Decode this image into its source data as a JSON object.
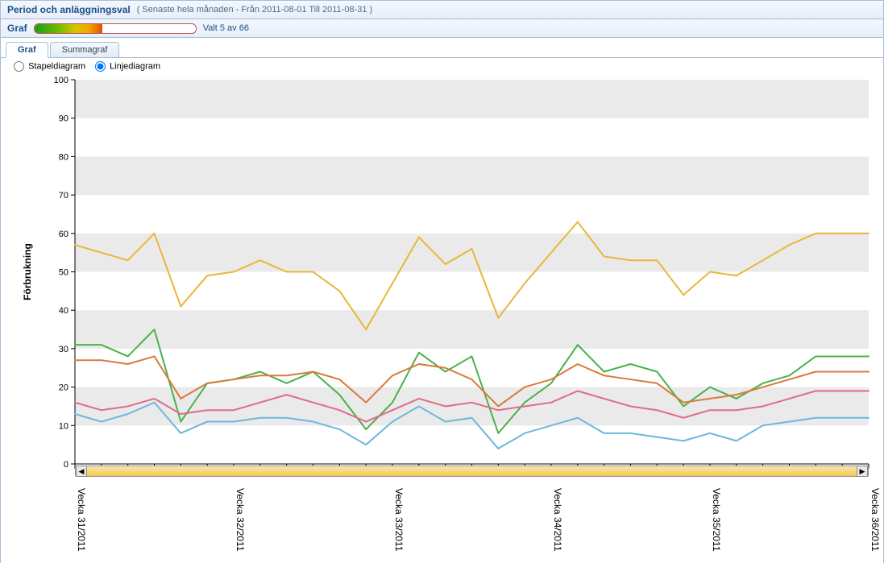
{
  "header1": {
    "title": "Period och anläggningsval",
    "subtitle": "(  Senaste hela månaden - Från 2011-08-01 Till 2011-08-31  )"
  },
  "header2": {
    "title": "Graf",
    "valtext": "Valt 5 av 66"
  },
  "tabs": {
    "items": [
      {
        "label": "Graf",
        "active": true
      },
      {
        "label": "Summagraf",
        "active": false
      }
    ]
  },
  "chart_options": {
    "bar_label": "Stapeldiagram",
    "line_label": "Linjediagram",
    "selected": "line"
  },
  "chart_data": {
    "type": "line",
    "ylabel": "Förbrukning",
    "ylim": [
      0,
      100
    ],
    "yticks": [
      0,
      10,
      20,
      30,
      40,
      50,
      60,
      70,
      80,
      90,
      100
    ],
    "x_major_labels": [
      "Vecka 31/2011",
      "Vecka 32/2011",
      "Vecka 33/2011",
      "Vecka 34/2011",
      "Vecka 35/2011",
      "Vecka 36/2011"
    ],
    "n_points": 31,
    "series": [
      {
        "name": "series-gold",
        "color": "#e7b738",
        "values": [
          57,
          55,
          53,
          60,
          41,
          49,
          50,
          53,
          50,
          50,
          45,
          35,
          47,
          59,
          52,
          56,
          38,
          47,
          55,
          63,
          54,
          53,
          53,
          44,
          50,
          49,
          53,
          57,
          60,
          60,
          60
        ]
      },
      {
        "name": "series-green",
        "color": "#4ab24a",
        "values": [
          31,
          31,
          28,
          35,
          11,
          21,
          22,
          24,
          21,
          24,
          18,
          9,
          16,
          29,
          24,
          28,
          8,
          16,
          21,
          31,
          24,
          26,
          24,
          15,
          20,
          17,
          21,
          23,
          28,
          28,
          28
        ]
      },
      {
        "name": "series-orange",
        "color": "#d97a3b",
        "values": [
          27,
          27,
          26,
          28,
          17,
          21,
          22,
          23,
          23,
          24,
          22,
          16,
          23,
          26,
          25,
          22,
          15,
          20,
          22,
          26,
          23,
          22,
          21,
          16,
          17,
          18,
          20,
          22,
          24,
          24,
          24
        ]
      },
      {
        "name": "series-rose",
        "color": "#e06a8c",
        "values": [
          16,
          14,
          15,
          17,
          13,
          14,
          14,
          16,
          18,
          16,
          14,
          11,
          14,
          17,
          15,
          16,
          14,
          15,
          16,
          19,
          17,
          15,
          14,
          12,
          14,
          14,
          15,
          17,
          19,
          19,
          19
        ]
      },
      {
        "name": "series-blue",
        "color": "#6db8da",
        "values": [
          13,
          11,
          13,
          16,
          8,
          11,
          11,
          12,
          12,
          11,
          9,
          5,
          11,
          15,
          11,
          12,
          4,
          8,
          10,
          12,
          8,
          8,
          7,
          6,
          8,
          6,
          10,
          11,
          12,
          12,
          12
        ]
      }
    ]
  }
}
